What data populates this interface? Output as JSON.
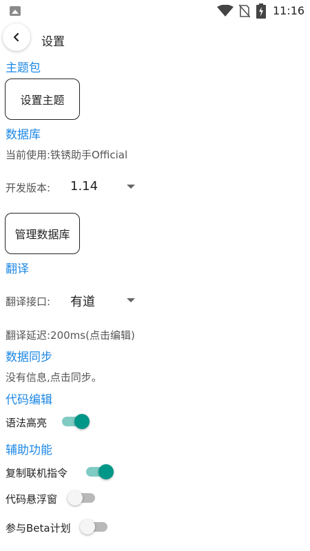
{
  "status_bar": {
    "time": "11:16",
    "icons": [
      "image-notification-icon",
      "wifi-icon",
      "no-sim-icon",
      "battery-charging-icon"
    ]
  },
  "header": {
    "title": "设置",
    "back_icon": "chevron-left-icon"
  },
  "theme_pack": {
    "heading": "主题包",
    "set_theme_button": "设置主题"
  },
  "database": {
    "heading": "数据库",
    "current_use": "当前使用:铁锈助手Official",
    "dev_version_label": "开发版本:",
    "dev_version_value": "1.14",
    "manage_button": "管理数据库"
  },
  "translation": {
    "heading": "翻译",
    "api_label": "翻译接口:",
    "api_value": "有道",
    "delay_text": "翻译延迟:200ms(点击编辑)"
  },
  "data_sync": {
    "heading": "数据同步",
    "info_text": "没有信息,点击同步。"
  },
  "code_edit": {
    "heading": "代码编辑",
    "syntax_highlight_label": "语法高亮",
    "syntax_highlight_on": true
  },
  "accessibility": {
    "heading": "辅助功能",
    "copy_command_label": "复制联机指令",
    "copy_command_on": true,
    "floating_window_label": "代码悬浮窗",
    "floating_window_on": false,
    "beta_label": "参与Beta计划",
    "beta_on": false
  },
  "colors": {
    "section_heading": "#1e88e5",
    "switch_on_thumb": "#009688",
    "switch_on_track": "#80cbc4"
  }
}
